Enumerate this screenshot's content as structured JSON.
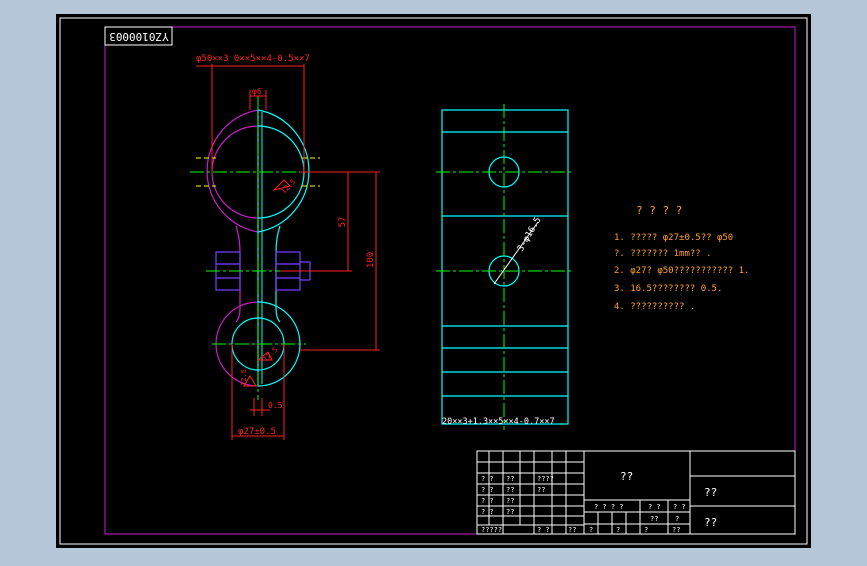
{
  "colors": {
    "background": "#b6c7da",
    "sheet": "#000000",
    "border": "#ffffff",
    "frame": "#c81ec8",
    "part": "#00ffff",
    "center": "#00ff00",
    "dimension": "#ff2020",
    "hidden": "#ffff00",
    "bolt": "#7a40ff",
    "notes": "#ffa020",
    "titleblock": "#ffffff"
  },
  "drawing_number": "YZ0100003",
  "dimensions": {
    "top_bore": "φ50××3  0××5××4-0.5××7",
    "small_top": "φ6",
    "center_distance": "57",
    "overall_length": "100",
    "thickness": "0.5",
    "bottom_bore": "φ27±0.5",
    "roughness_1": "12.5",
    "roughness_2": "12.5",
    "roughness_3": "12.5",
    "side_hole": "3-φ16.5",
    "side_view_width": "20××3+1.3××5××4-0.7××7"
  },
  "notes": {
    "title": "? ? ? ?",
    "lines": [
      "1. ?????   φ27±0.5??  φ50",
      "   ?. ???????   1mm??   .",
      "2. φ27?  φ50???????????    1.",
      "3. 16.5????????    0.5.",
      "4. ??????????    ."
    ]
  },
  "title_block": {
    "part_name": "??",
    "right_top": "??",
    "right_bottom": "??",
    "rev_rows": [
      [
        "? ?",
        "??",
        "????"
      ],
      [
        "? ?",
        "??",
        "??"
      ],
      [
        "? ?",
        "??",
        ""
      ],
      [
        "? ?",
        "??",
        ""
      ],
      [
        "?????",
        "? ?",
        "??"
      ]
    ],
    "stage_labels": [
      "? ? ? ?",
      "? ?",
      "? ?"
    ],
    "stage_values": [
      "",
      "??",
      "?"
    ],
    "bottom_labels": [
      "?",
      "?",
      "?",
      "??"
    ],
    "scale_cells": [
      "? ?",
      "? ?"
    ]
  }
}
